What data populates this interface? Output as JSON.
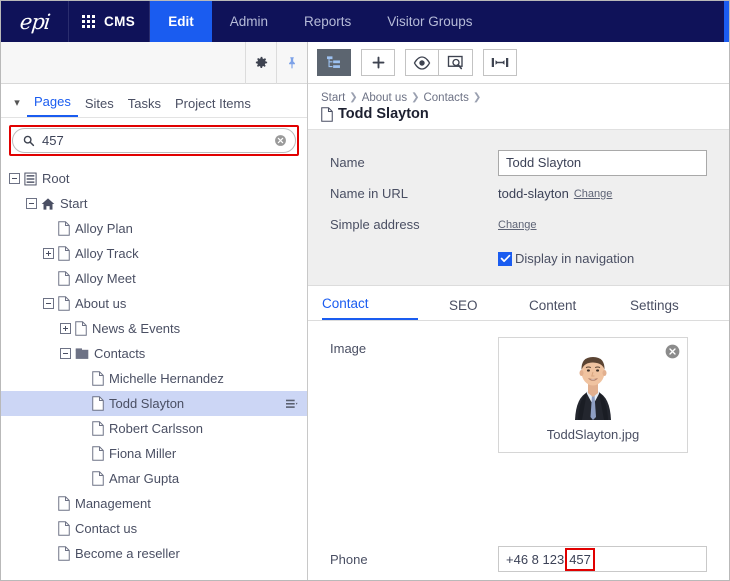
{
  "topnav": {
    "logo": "epi",
    "grid_icon": "apps-grid-icon",
    "product": "CMS",
    "tabs": [
      {
        "label": "Edit",
        "active": true
      },
      {
        "label": "Admin",
        "active": false
      },
      {
        "label": "Reports",
        "active": false
      },
      {
        "label": "Visitor Groups",
        "active": false
      }
    ],
    "accent_color": "#1a5cf0",
    "bg_color": "#0f1259"
  },
  "left_panel": {
    "toolbar": {
      "settings_icon": "gear-icon",
      "pin_icon": "pin-icon"
    },
    "collapse_icon": "chevron-down-icon",
    "tabs": [
      {
        "label": "Pages",
        "active": true
      },
      {
        "label": "Sites",
        "active": false
      },
      {
        "label": "Tasks",
        "active": false
      },
      {
        "label": "Project Items",
        "active": false
      }
    ],
    "search": {
      "value": "457",
      "placeholder": "Search",
      "search_icon": "search-icon",
      "clear_icon": "clear-circle-icon",
      "highlight_color": "#e10000"
    },
    "tree": [
      {
        "label": "Root",
        "depth": 0,
        "toggle": "minus",
        "icon": "list-icon",
        "selected": false
      },
      {
        "label": "Start",
        "depth": 1,
        "toggle": "minus",
        "icon": "home-icon",
        "selected": false
      },
      {
        "label": "Alloy Plan",
        "depth": 2,
        "toggle": "none",
        "icon": "page-icon",
        "selected": false
      },
      {
        "label": "Alloy Track",
        "depth": 2,
        "toggle": "plus",
        "icon": "page-icon",
        "selected": false
      },
      {
        "label": "Alloy Meet",
        "depth": 2,
        "toggle": "none",
        "icon": "page-icon",
        "selected": false
      },
      {
        "label": "About us",
        "depth": 2,
        "toggle": "minus",
        "icon": "page-icon",
        "selected": false
      },
      {
        "label": "News & Events",
        "depth": 3,
        "toggle": "plus",
        "icon": "page-icon",
        "selected": false
      },
      {
        "label": "Contacts",
        "depth": 3,
        "toggle": "minus",
        "icon": "folder-icon",
        "selected": false
      },
      {
        "label": "Michelle Hernandez",
        "depth": 4,
        "toggle": "none",
        "icon": "page-icon",
        "selected": false
      },
      {
        "label": "Todd Slayton",
        "depth": 4,
        "toggle": "none",
        "icon": "page-icon",
        "selected": true,
        "row_menu_icon": "context-menu-icon"
      },
      {
        "label": "Robert Carlsson",
        "depth": 4,
        "toggle": "none",
        "icon": "page-icon",
        "selected": false
      },
      {
        "label": "Fiona Miller",
        "depth": 4,
        "toggle": "none",
        "icon": "page-icon",
        "selected": false
      },
      {
        "label": "Amar Gupta",
        "depth": 4,
        "toggle": "none",
        "icon": "page-icon",
        "selected": false
      },
      {
        "label": "Management",
        "depth": 2,
        "toggle": "none",
        "icon": "page-icon",
        "selected": false
      },
      {
        "label": "Contact us",
        "depth": 2,
        "toggle": "none",
        "icon": "page-icon",
        "selected": false
      },
      {
        "label": "Become a reseller",
        "depth": 2,
        "toggle": "none",
        "icon": "page-icon",
        "selected": false
      }
    ]
  },
  "right_panel": {
    "toolbar_buttons": [
      {
        "name": "page-tree-toggle",
        "icon": "tree-structure-icon",
        "active": true
      },
      {
        "name": "create-new",
        "icon": "plus-icon",
        "active": false
      },
      {
        "name": "view-on-site",
        "icon": "eye-icon",
        "active": false
      },
      {
        "name": "preview",
        "icon": "preview-search-icon",
        "active": false
      },
      {
        "name": "toggle-panels",
        "icon": "expand-arrows-icon",
        "active": true
      }
    ],
    "breadcrumb": [
      "Start",
      "About us",
      "Contacts"
    ],
    "page_title": "Todd Slayton",
    "page_title_icon": "page-icon",
    "properties": [
      {
        "label": "Name",
        "type": "input",
        "value": "Todd Slayton"
      },
      {
        "label": "Name in URL",
        "type": "text",
        "value": "todd-slayton",
        "action": "Change"
      },
      {
        "label": "Simple address",
        "type": "linkonly",
        "value": "",
        "action": "Change"
      }
    ],
    "checkbox": {
      "label": "Display in navigation",
      "checked": true,
      "color": "#1a5cf0"
    },
    "content_tabs": [
      {
        "label": "Contact",
        "active": true
      },
      {
        "label": "SEO",
        "active": false
      },
      {
        "label": "Content",
        "active": false
      },
      {
        "label": "Settings",
        "active": false
      }
    ],
    "image_field": {
      "label": "Image",
      "filename": "ToddSlayton.jpg",
      "remove_icon": "close-circle-icon",
      "thumbnail_alt": "portrait-photo"
    },
    "phone_field": {
      "label": "Phone",
      "value_prefix": "+46 8 123",
      "value_highlight": "457",
      "highlight_color": "#e10000"
    }
  }
}
